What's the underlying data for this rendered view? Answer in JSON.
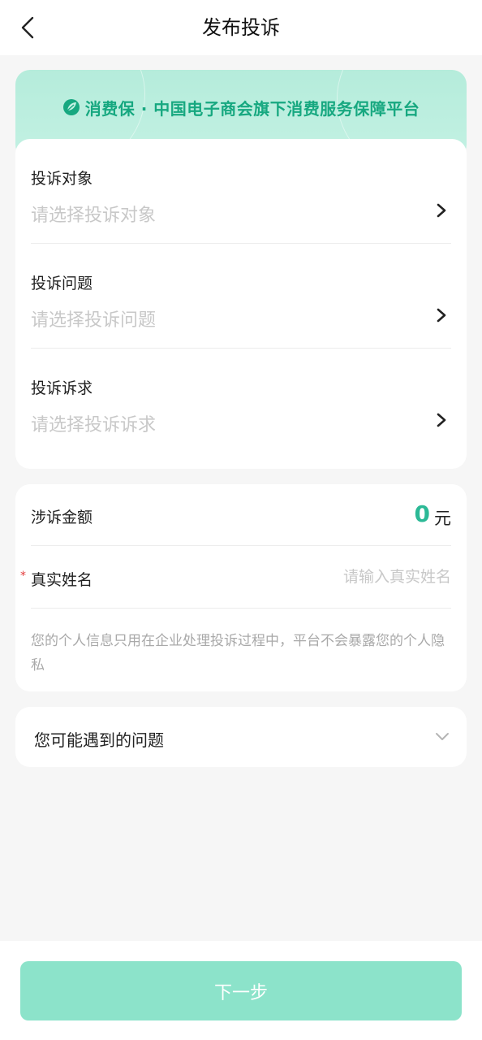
{
  "header": {
    "title": "发布投诉"
  },
  "banner": {
    "text": "消费保 · 中国电子商会旗下消费服务保障平台",
    "accent_color": "#17a880"
  },
  "form": {
    "fields": [
      {
        "label": "投诉对象",
        "placeholder": "请选择投诉对象"
      },
      {
        "label": "投诉问题",
        "placeholder": "请选择投诉问题"
      },
      {
        "label": "投诉诉求",
        "placeholder": "请选择投诉诉求"
      }
    ],
    "amount": {
      "label": "涉诉金额",
      "value": "0",
      "unit": "元"
    },
    "name": {
      "required_mark": "*",
      "label": "真实姓名",
      "placeholder": "请输入真实姓名"
    },
    "privacy_note": "您的个人信息只用在企业处理投诉过程中，平台不会暴露您的个人隐私"
  },
  "faq": {
    "label": "您可能遇到的问题"
  },
  "footer": {
    "next_label": "下一步"
  },
  "colors": {
    "brand": "#2cb996",
    "button": "#8ce3ca",
    "placeholder": "#c8c8c8"
  },
  "icons": {
    "back": "chevron-left-icon",
    "select": "chevron-right-icon",
    "expand": "chevron-down-icon",
    "logo": "leaf-logo-icon"
  }
}
